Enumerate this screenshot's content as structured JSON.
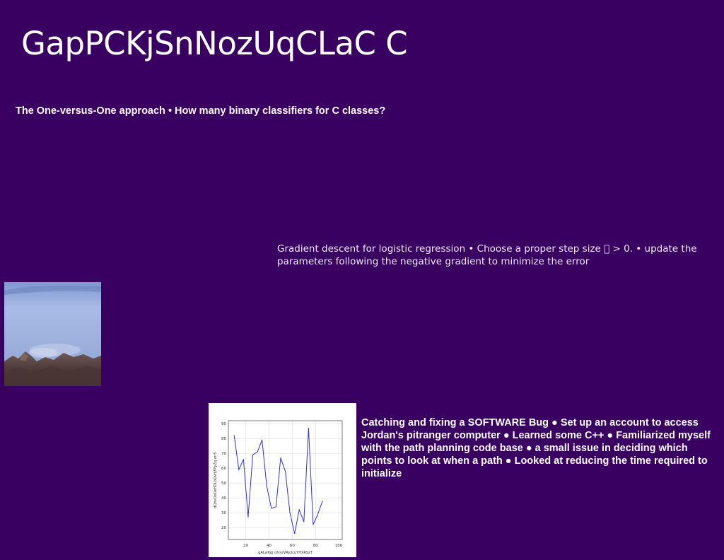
{
  "slide": {
    "title": "GapPCKjSnNozUqCLaC C",
    "subtitle": "The One-versus-One approach • How many binary classifiers for C classes?",
    "body_text": "Gradient descent for logistic regression • Choose a proper step size \u0000 > 0. • update the parameters following the negative gradient to minimize the error",
    "notes_text": "Catching and fixing a SOFTWARE Bug ● Set up an account to access Jordan's pitranger computer ● Learned some C++ ● Familiarized myself with the path planning code base ● a small issue in deciding which points to look at when a path ● Looked at reducing the time required to initialize",
    "background_color": "#390062"
  },
  "photo": {
    "icon": "mountain-landscape-photo"
  },
  "chart_data": {
    "type": "line",
    "x": [
      10,
      14,
      18,
      22,
      26,
      30,
      34,
      38,
      42,
      46,
      50,
      54,
      58,
      62,
      66,
      70,
      74,
      78,
      82,
      86,
      90,
      94,
      98,
      102
    ],
    "series": [
      {
        "values": [
          82,
          59,
          66,
          27,
          69,
          71,
          79,
          48,
          33,
          34,
          67,
          58,
          30,
          16,
          32,
          24,
          87,
          22,
          29,
          38
        ],
        "color": "#3333cc"
      }
    ],
    "xlabel": "gALwKgj ofyyrVRjclcuYHXRSzT",
    "ylabel": "dQhvOoDeHDLbDvfIjFPyZq etrS",
    "xticks": [
      20,
      40,
      60,
      80,
      100
    ],
    "yticks": [
      20,
      30,
      40,
      50,
      60,
      70,
      80,
      90
    ],
    "xlim": [
      5,
      103
    ],
    "ylim": [
      12,
      92
    ],
    "grid": true
  }
}
